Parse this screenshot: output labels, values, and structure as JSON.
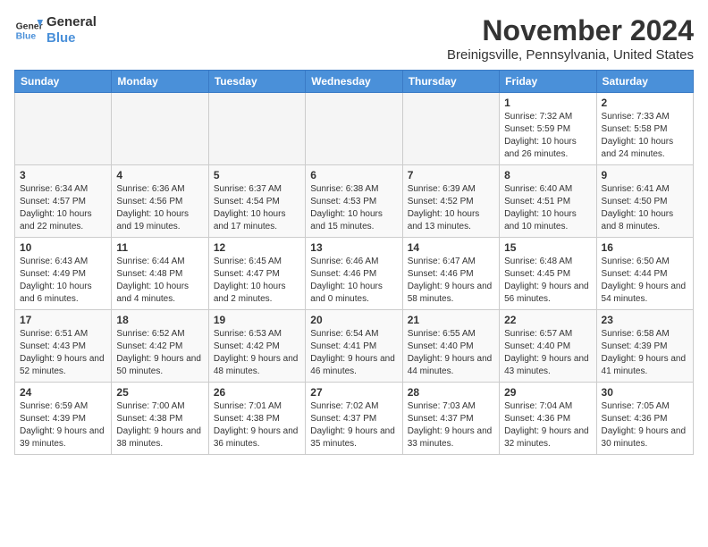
{
  "header": {
    "logo_general": "General",
    "logo_blue": "Blue",
    "month_title": "November 2024",
    "location": "Breinigsville, Pennsylvania, United States"
  },
  "days_of_week": [
    "Sunday",
    "Monday",
    "Tuesday",
    "Wednesday",
    "Thursday",
    "Friday",
    "Saturday"
  ],
  "weeks": [
    [
      {
        "day": "",
        "info": ""
      },
      {
        "day": "",
        "info": ""
      },
      {
        "day": "",
        "info": ""
      },
      {
        "day": "",
        "info": ""
      },
      {
        "day": "",
        "info": ""
      },
      {
        "day": "1",
        "info": "Sunrise: 7:32 AM\nSunset: 5:59 PM\nDaylight: 10 hours and 26 minutes."
      },
      {
        "day": "2",
        "info": "Sunrise: 7:33 AM\nSunset: 5:58 PM\nDaylight: 10 hours and 24 minutes."
      }
    ],
    [
      {
        "day": "3",
        "info": "Sunrise: 6:34 AM\nSunset: 4:57 PM\nDaylight: 10 hours and 22 minutes."
      },
      {
        "day": "4",
        "info": "Sunrise: 6:36 AM\nSunset: 4:56 PM\nDaylight: 10 hours and 19 minutes."
      },
      {
        "day": "5",
        "info": "Sunrise: 6:37 AM\nSunset: 4:54 PM\nDaylight: 10 hours and 17 minutes."
      },
      {
        "day": "6",
        "info": "Sunrise: 6:38 AM\nSunset: 4:53 PM\nDaylight: 10 hours and 15 minutes."
      },
      {
        "day": "7",
        "info": "Sunrise: 6:39 AM\nSunset: 4:52 PM\nDaylight: 10 hours and 13 minutes."
      },
      {
        "day": "8",
        "info": "Sunrise: 6:40 AM\nSunset: 4:51 PM\nDaylight: 10 hours and 10 minutes."
      },
      {
        "day": "9",
        "info": "Sunrise: 6:41 AM\nSunset: 4:50 PM\nDaylight: 10 hours and 8 minutes."
      }
    ],
    [
      {
        "day": "10",
        "info": "Sunrise: 6:43 AM\nSunset: 4:49 PM\nDaylight: 10 hours and 6 minutes."
      },
      {
        "day": "11",
        "info": "Sunrise: 6:44 AM\nSunset: 4:48 PM\nDaylight: 10 hours and 4 minutes."
      },
      {
        "day": "12",
        "info": "Sunrise: 6:45 AM\nSunset: 4:47 PM\nDaylight: 10 hours and 2 minutes."
      },
      {
        "day": "13",
        "info": "Sunrise: 6:46 AM\nSunset: 4:46 PM\nDaylight: 10 hours and 0 minutes."
      },
      {
        "day": "14",
        "info": "Sunrise: 6:47 AM\nSunset: 4:46 PM\nDaylight: 9 hours and 58 minutes."
      },
      {
        "day": "15",
        "info": "Sunrise: 6:48 AM\nSunset: 4:45 PM\nDaylight: 9 hours and 56 minutes."
      },
      {
        "day": "16",
        "info": "Sunrise: 6:50 AM\nSunset: 4:44 PM\nDaylight: 9 hours and 54 minutes."
      }
    ],
    [
      {
        "day": "17",
        "info": "Sunrise: 6:51 AM\nSunset: 4:43 PM\nDaylight: 9 hours and 52 minutes."
      },
      {
        "day": "18",
        "info": "Sunrise: 6:52 AM\nSunset: 4:42 PM\nDaylight: 9 hours and 50 minutes."
      },
      {
        "day": "19",
        "info": "Sunrise: 6:53 AM\nSunset: 4:42 PM\nDaylight: 9 hours and 48 minutes."
      },
      {
        "day": "20",
        "info": "Sunrise: 6:54 AM\nSunset: 4:41 PM\nDaylight: 9 hours and 46 minutes."
      },
      {
        "day": "21",
        "info": "Sunrise: 6:55 AM\nSunset: 4:40 PM\nDaylight: 9 hours and 44 minutes."
      },
      {
        "day": "22",
        "info": "Sunrise: 6:57 AM\nSunset: 4:40 PM\nDaylight: 9 hours and 43 minutes."
      },
      {
        "day": "23",
        "info": "Sunrise: 6:58 AM\nSunset: 4:39 PM\nDaylight: 9 hours and 41 minutes."
      }
    ],
    [
      {
        "day": "24",
        "info": "Sunrise: 6:59 AM\nSunset: 4:39 PM\nDaylight: 9 hours and 39 minutes."
      },
      {
        "day": "25",
        "info": "Sunrise: 7:00 AM\nSunset: 4:38 PM\nDaylight: 9 hours and 38 minutes."
      },
      {
        "day": "26",
        "info": "Sunrise: 7:01 AM\nSunset: 4:38 PM\nDaylight: 9 hours and 36 minutes."
      },
      {
        "day": "27",
        "info": "Sunrise: 7:02 AM\nSunset: 4:37 PM\nDaylight: 9 hours and 35 minutes."
      },
      {
        "day": "28",
        "info": "Sunrise: 7:03 AM\nSunset: 4:37 PM\nDaylight: 9 hours and 33 minutes."
      },
      {
        "day": "29",
        "info": "Sunrise: 7:04 AM\nSunset: 4:36 PM\nDaylight: 9 hours and 32 minutes."
      },
      {
        "day": "30",
        "info": "Sunrise: 7:05 AM\nSunset: 4:36 PM\nDaylight: 9 hours and 30 minutes."
      }
    ]
  ]
}
